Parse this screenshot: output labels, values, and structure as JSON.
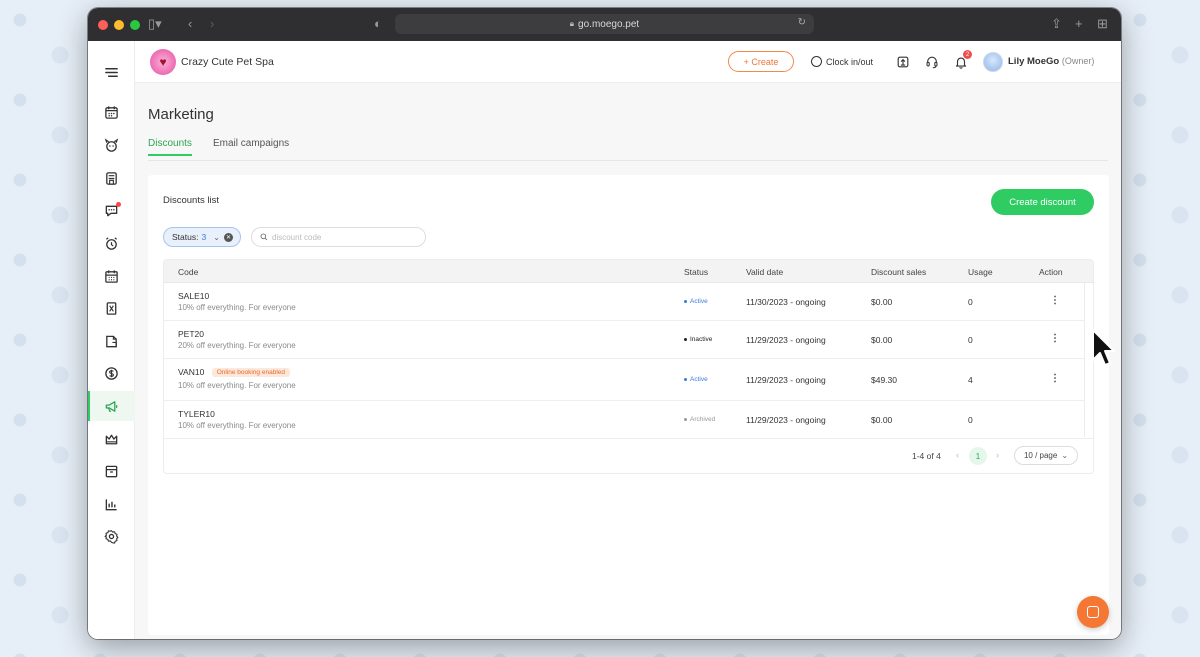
{
  "browser": {
    "url": "go.moego.pet"
  },
  "topbar": {
    "business_name": "Crazy Cute Pet Spa",
    "create_label": "+ Create",
    "clock_label": "Clock in/out",
    "notification_count": "2",
    "user_name": "Lily MoeGo",
    "user_role": "(Owner)"
  },
  "sidebar": {
    "items": [
      {
        "name": "menu-icon"
      },
      {
        "name": "calendar-icon"
      },
      {
        "name": "pet-icon"
      },
      {
        "name": "store-icon"
      },
      {
        "name": "message-icon",
        "badge": true
      },
      {
        "name": "alarm-icon"
      },
      {
        "name": "schedule-icon"
      },
      {
        "name": "report-card-icon"
      },
      {
        "name": "document-icon"
      },
      {
        "name": "dollar-icon"
      },
      {
        "name": "megaphone-icon",
        "active": true
      },
      {
        "name": "crown-icon"
      },
      {
        "name": "archive-icon"
      },
      {
        "name": "chart-icon"
      },
      {
        "name": "gear-icon"
      }
    ]
  },
  "page": {
    "title": "Marketing",
    "tabs": [
      {
        "label": "Discounts",
        "active": true
      },
      {
        "label": "Email campaigns",
        "active": false
      }
    ]
  },
  "discounts": {
    "list_title": "Discounts list",
    "create_button": "Create discount",
    "filter": {
      "status_label": "Status:",
      "status_count": "3"
    },
    "search": {
      "placeholder": "discount code"
    },
    "columns": [
      "Code",
      "Status",
      "Valid date",
      "Discount sales",
      "Usage",
      "Action"
    ],
    "rows": [
      {
        "code": "SALE10",
        "desc": "10% off everything. For everyone",
        "tag": "",
        "status": "Active",
        "status_color": "#3b7be0",
        "valid": "11/30/2023 - ongoing",
        "sales": "$0.00",
        "usage": "0",
        "has_action": true
      },
      {
        "code": "PET20",
        "desc": "20% off everything. For everyone",
        "tag": "",
        "status": "Inactive",
        "status_color": "#222222",
        "valid": "11/29/2023 - ongoing",
        "sales": "$0.00",
        "usage": "0",
        "has_action": true
      },
      {
        "code": "VAN10",
        "desc": "10% off everything. For everyone",
        "tag": "Online booking enabled",
        "status": "Active",
        "status_color": "#3b7be0",
        "valid": "11/29/2023 - ongoing",
        "sales": "$49.30",
        "usage": "4",
        "has_action": true
      },
      {
        "code": "TYLER10",
        "desc": "10% off everything. For everyone",
        "tag": "",
        "status": "Archived",
        "status_color": "#999999",
        "valid": "11/29/2023 - ongoing",
        "sales": "$0.00",
        "usage": "0",
        "has_action": false
      }
    ],
    "pagination": {
      "info": "1-4 of 4",
      "current_page": "1",
      "page_size": "10 / page"
    }
  }
}
